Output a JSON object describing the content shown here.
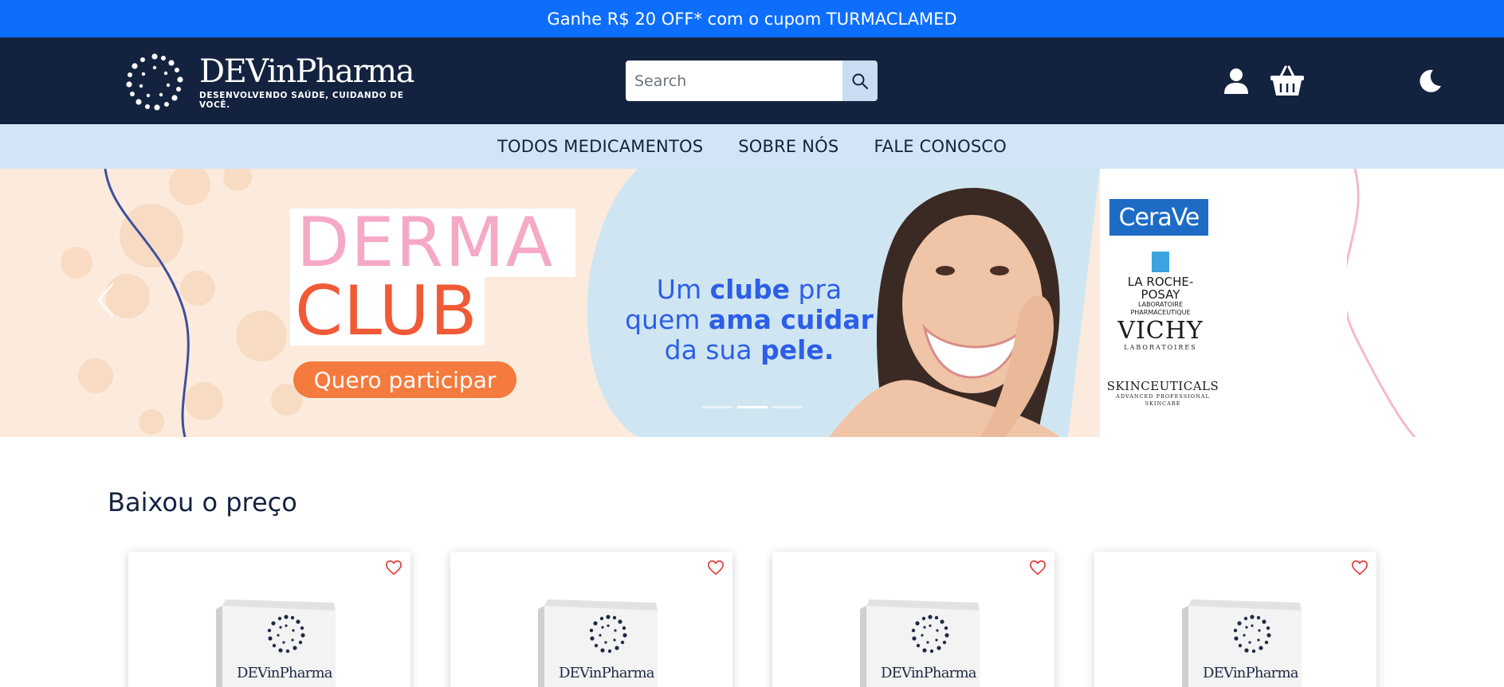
{
  "promo": {
    "text": "Ganhe R$ 20 OFF* com o cupom TURMACLAMED"
  },
  "header": {
    "logo_name": "DEVinPharma",
    "logo_tagline": "DESENVOLVENDO SAÚDE, CUIDANDO DE VOCÊ.",
    "search_placeholder": "Search",
    "icons": [
      "search-icon",
      "user-icon",
      "basket-icon",
      "moon-icon"
    ]
  },
  "nav": {
    "items": [
      {
        "label": "TODOS MEDICAMENTOS"
      },
      {
        "label": "SOBRE NÓS"
      },
      {
        "label": "FALE CONOSCO"
      }
    ]
  },
  "banner": {
    "title_line1": "DERMA",
    "title_line2": "CLUB",
    "cta_label": "Quero participar",
    "slogan": {
      "p1": "Um ",
      "b1": "clube",
      "p2": " pra",
      "p3": "quem ",
      "b2": "ama cuidar",
      "p4": "da sua ",
      "b3": "pele",
      "p5": "."
    },
    "brands": {
      "cerave": "CeraVe",
      "lrp_line1": "LA ROCHE-POSAY",
      "lrp_line2": "LABORATOIRE PHARMACEUTIQUE",
      "vichy": "VICHY",
      "vichy_sub": "LABORATOIRES",
      "skin": "SKINCEUTICALS",
      "skin_sub": "ADVANCED PROFESSIONAL SKINCARE"
    },
    "indicator_count": 3,
    "active_indicator": 1
  },
  "section": {
    "title": "Baixou o preço",
    "cards": [
      {
        "brand": "DEVinPharma"
      },
      {
        "brand": "DEVinPharma"
      },
      {
        "brand": "DEVinPharma"
      },
      {
        "brand": "DEVinPharma"
      }
    ]
  },
  "colors": {
    "promo": "#0d6efd",
    "header": "#13233f",
    "nav": "#d3e4f6",
    "accent_heart": "#e53935"
  }
}
